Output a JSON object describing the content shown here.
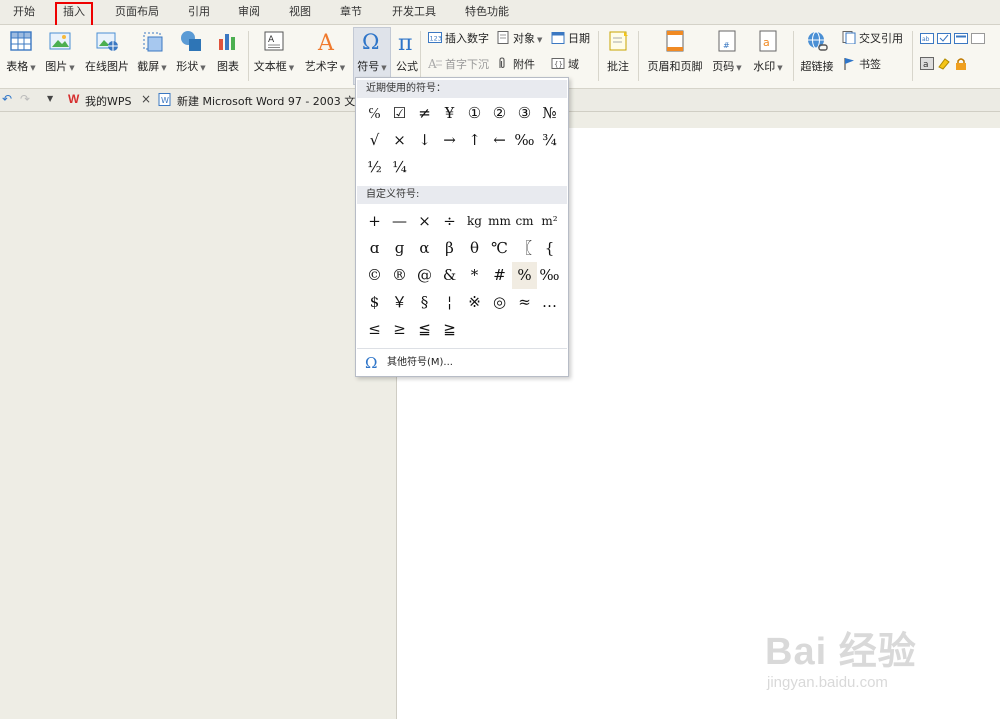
{
  "menu": {
    "tabs": [
      "开始",
      "插入",
      "页面布局",
      "引用",
      "审阅",
      "视图",
      "章节",
      "开发工具",
      "特色功能"
    ]
  },
  "ribbon": {
    "table": "表格",
    "picture": "图片",
    "online_picture": "在线图片",
    "screenshot": "截屏",
    "shape": "形状",
    "chart": "图表",
    "textbox": "文本框",
    "wordart": "艺术字",
    "symbol": "符号",
    "formula": "公式",
    "insert_number": "插入数字",
    "drop_cap": "首字下沉",
    "object": "对象",
    "attachment": "附件",
    "date": "日期",
    "field": "域",
    "comment": "批注",
    "header_footer": "页眉和页脚",
    "page_number": "页码",
    "watermark": "水印",
    "hyperlink": "超链接",
    "cross_ref": "交叉引用",
    "bookmark": "书签"
  },
  "tabbar": {
    "mywps": "我的WPS",
    "doc": "新建 Microsoft Word 97 - 2003 文"
  },
  "symbol_menu": {
    "recent_title": "近期使用的符号：",
    "recent": [
      "℅",
      "☑",
      "≠",
      "¥",
      "①",
      "②",
      "③",
      "№",
      "√",
      "×",
      "↓",
      "→",
      "↑",
      "←",
      "‰",
      "¾",
      "½",
      "¼"
    ],
    "custom_title": "自定义符号:",
    "custom": [
      "+",
      "—",
      "×",
      "÷",
      "kg",
      "mm",
      "cm",
      "m²",
      "ɑ",
      "ɡ",
      "α",
      "β",
      "θ",
      "℃",
      "〖",
      "{",
      "©",
      "®",
      "@",
      "&",
      "*",
      "#",
      "%",
      "‰",
      "$",
      "￥",
      "§",
      "¦",
      "※",
      "◎",
      "≈",
      "…",
      "≤",
      "≥",
      "≦",
      "≧"
    ],
    "more": "其他符号(M)..."
  },
  "watermark": {
    "main": "Bai 经验",
    "sub": "jingyan.baidu.com"
  },
  "colors": {
    "accent_box": "#ee0000",
    "symbol_blue": "#2e75c9"
  }
}
